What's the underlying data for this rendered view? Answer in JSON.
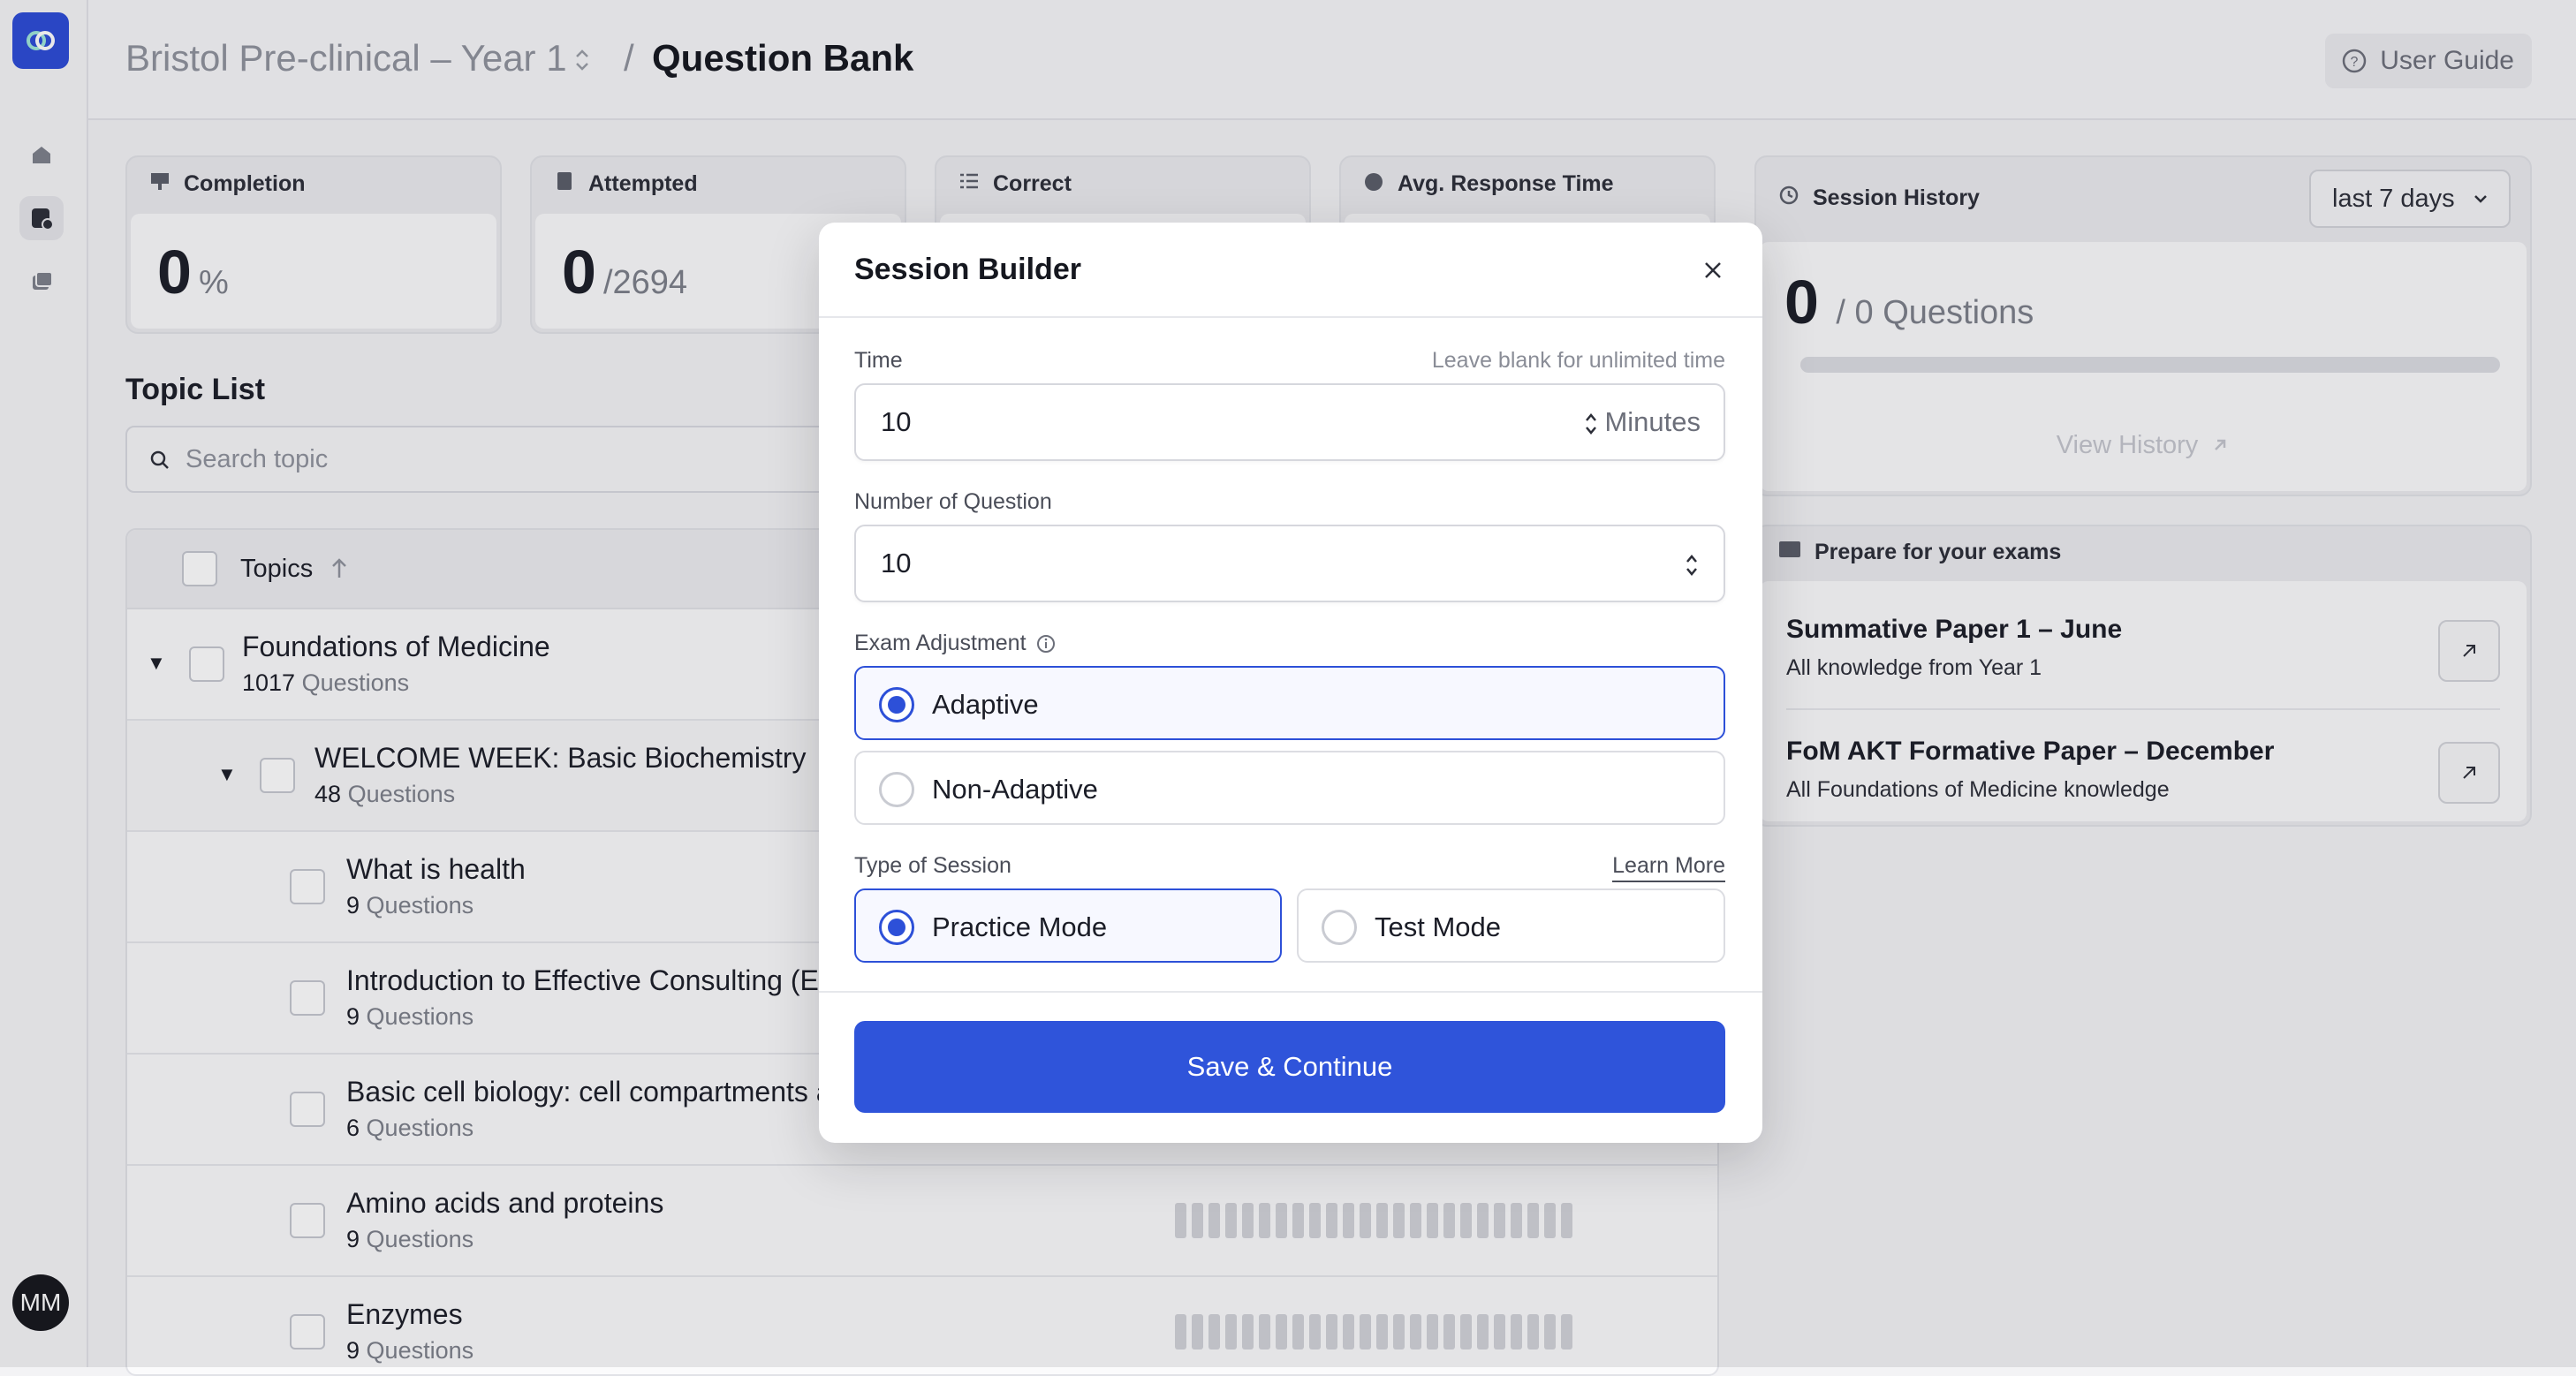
{
  "sidebar": {
    "logo_icon": "app-logo-icon",
    "nav_icons": [
      "home-icon",
      "question-bank-icon",
      "library-icon"
    ],
    "avatar_initials": "MM"
  },
  "header": {
    "course": "Bristol Pre-clinical – Year 1",
    "separator": "/",
    "page": "Question Bank",
    "user_guide": "User Guide"
  },
  "stats": {
    "completion": {
      "label": "Completion",
      "value": "0",
      "unit": "%"
    },
    "attempted": {
      "label": "Attempted",
      "value": "0",
      "unit": "/2694"
    },
    "correct": {
      "label": "Correct"
    },
    "avg_response": {
      "label": "Avg. Response Time"
    }
  },
  "topics": {
    "title": "Topic List",
    "search_placeholder": "Search topic",
    "column_header": "Topics",
    "questions_word": "Questions",
    "rows": [
      {
        "title": "Foundations of Medicine",
        "count": "1017"
      },
      {
        "title": "WELCOME WEEK: Basic Biochemistry",
        "count": "48"
      },
      {
        "title": "What is health",
        "count": "9"
      },
      {
        "title": "Introduction to Effective Consulting (E",
        "count": "9"
      },
      {
        "title": "Basic cell biology: cell compartments a",
        "count": "6"
      },
      {
        "title": "Amino acids and proteins",
        "count": "9"
      },
      {
        "title": "Enzymes",
        "count": "9"
      }
    ]
  },
  "session_history": {
    "label": "Session History",
    "range": "last 7 days",
    "value": "0",
    "total": "/ 0 Questions",
    "view_history": "View History"
  },
  "prepare": {
    "label": "Prepare for your exams",
    "exams": [
      {
        "title": "Summative Paper 1 – June",
        "subtitle": "All knowledge from Year 1"
      },
      {
        "title": "FoM AKT Formative Paper – December",
        "subtitle": "All Foundations of Medicine knowledge"
      }
    ]
  },
  "modal": {
    "title": "Session Builder",
    "time_label": "Time",
    "time_hint": "Leave blank for unlimited time",
    "time_value": "10",
    "time_unit": "Minutes",
    "num_label": "Number of Question",
    "num_value": "10",
    "exam_adjust_label": "Exam Adjustment",
    "adaptive": "Adaptive",
    "non_adaptive": "Non-Adaptive",
    "session_type_label": "Type of Session",
    "learn_more": "Learn More",
    "practice": "Practice Mode",
    "test": "Test Mode",
    "save": "Save & Continue",
    "selected_adjustment": "Adaptive",
    "selected_type": "Practice Mode"
  },
  "colors": {
    "accent": "#2f54da",
    "brand": "#2c4bd6"
  }
}
